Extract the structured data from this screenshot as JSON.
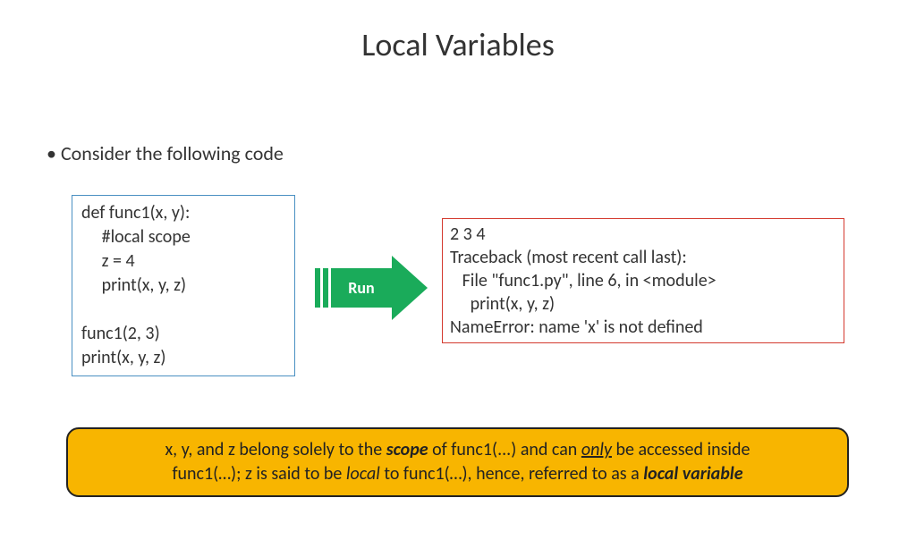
{
  "title": "Local Variables",
  "bullet": "Consider the following code",
  "code": "def func1(x, y):\n     #local scope\n     z = 4\n     print(x, y, z)\n\nfunc1(2, 3)\nprint(x, y, z)",
  "arrow_label": "Run",
  "output": "2 3 4\nTraceback (most recent call last):\n   File \"func1.py\", line 6, in <module>\n     print(x, y, z)\nNameError: name 'x' is not defined",
  "callout": {
    "line1_a": "x, y, and z belong solely to the ",
    "line1_b": "scope",
    "line1_c": " of func1(...) and can ",
    "line1_d": "only",
    "line1_e": " be accessed inside",
    "line2_a": "func1(…); z is said to be ",
    "line2_b": "local",
    "line2_c": " to func1(…), hence, referred to as a ",
    "line2_d": "local variable"
  }
}
